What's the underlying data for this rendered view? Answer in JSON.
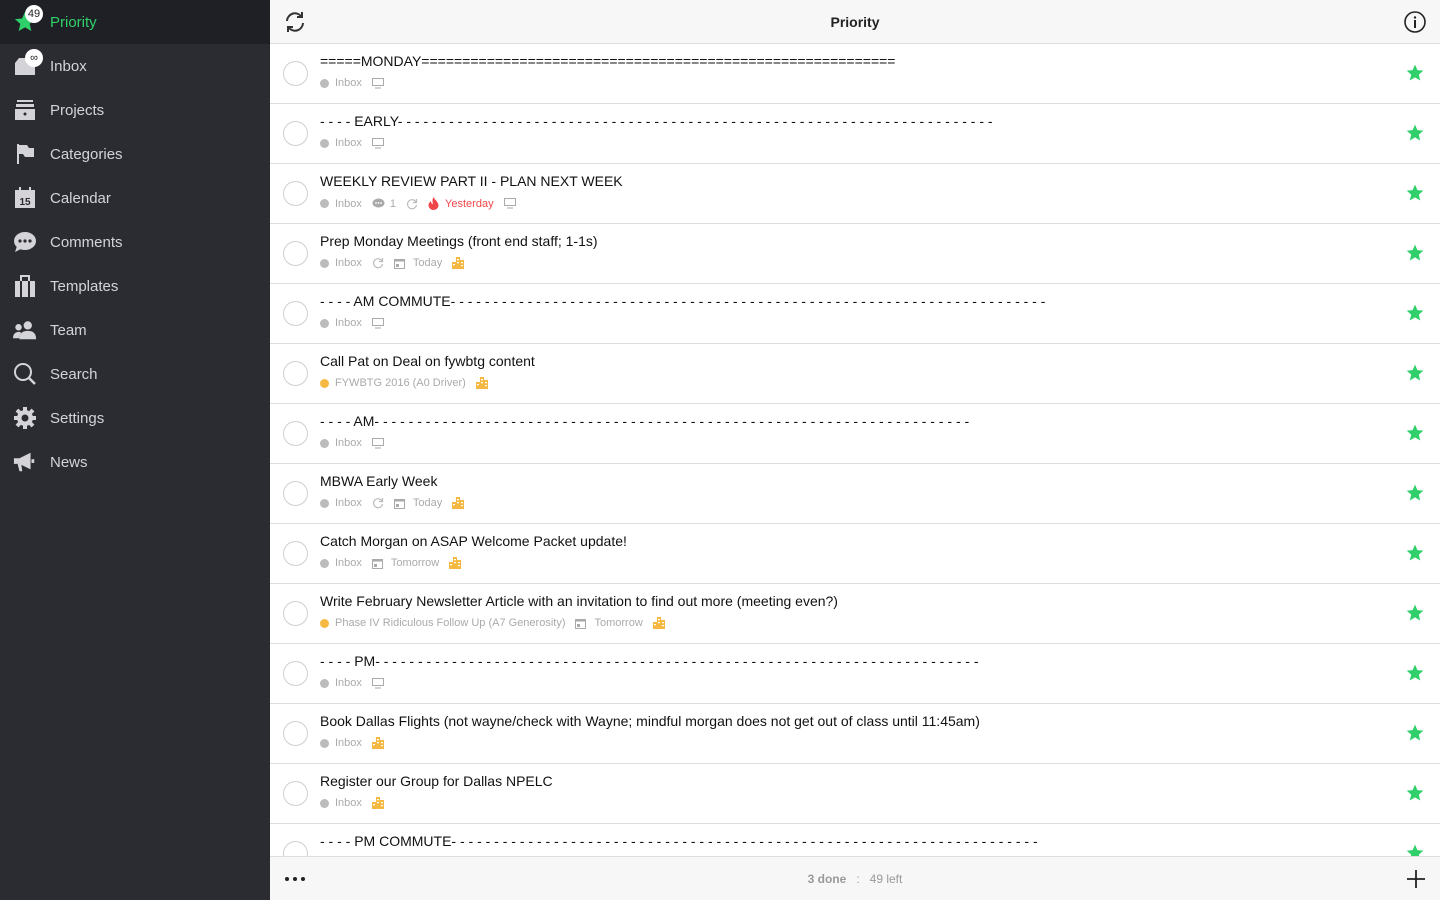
{
  "colors": {
    "accent": "#2fd06a",
    "sidebar": "#2b2c32",
    "overdue": "#f0464a",
    "project_orange": "#f5b942",
    "inbox_gray": "#bbbbbb"
  },
  "sidebar": {
    "items": [
      {
        "label": "Priority",
        "icon": "star-icon",
        "badge": "49",
        "active": true
      },
      {
        "label": "Inbox",
        "icon": "inbox-icon",
        "badge": "∞"
      },
      {
        "label": "Projects",
        "icon": "projects-icon"
      },
      {
        "label": "Categories",
        "icon": "flag-icon"
      },
      {
        "label": "Calendar",
        "icon": "calendar-icon",
        "icon_text": "15"
      },
      {
        "label": "Comments",
        "icon": "comment-icon"
      },
      {
        "label": "Templates",
        "icon": "templates-icon"
      },
      {
        "label": "Team",
        "icon": "team-icon"
      },
      {
        "label": "Search",
        "icon": "search-icon"
      },
      {
        "label": "Settings",
        "icon": "gear-icon"
      },
      {
        "label": "News",
        "icon": "megaphone-icon"
      }
    ]
  },
  "header": {
    "title": "Priority",
    "left_icon": "refresh-icon",
    "right_icon": "info-icon"
  },
  "tasks": [
    {
      "title": "=====MONDAY==========================================================",
      "meta": [
        {
          "t": "project",
          "text": "Inbox",
          "color": "#bbbbbb"
        },
        {
          "t": "monitor"
        }
      ]
    },
    {
      "title": "- - - - EARLY- - - - - - - - - - - - - - - - - - - - - - - - - - - - - - - - - - - - - - - - - - - - - - - - - - - - - - - - - - - - - - - - - - - - - -",
      "meta": [
        {
          "t": "project",
          "text": "Inbox",
          "color": "#bbbbbb"
        },
        {
          "t": "monitor"
        }
      ]
    },
    {
      "title": "WEEKLY REVIEW PART II - PLAN NEXT WEEK",
      "meta": [
        {
          "t": "project",
          "text": "Inbox",
          "color": "#bbbbbb"
        },
        {
          "t": "comment",
          "text": "1"
        },
        {
          "t": "repeat"
        },
        {
          "t": "overdue",
          "text": "Yesterday"
        },
        {
          "t": "monitor"
        }
      ]
    },
    {
      "title": "Prep Monday Meetings (front end staff; 1-1s)",
      "meta": [
        {
          "t": "project",
          "text": "Inbox",
          "color": "#bbbbbb"
        },
        {
          "t": "repeat"
        },
        {
          "t": "date",
          "text": "Today"
        },
        {
          "t": "building"
        }
      ]
    },
    {
      "title": "- - - - AM COMMUTE- - - - - - - - - - - - - - - - - - - - - - - - - - - - - - - - - - - - - - - - - - - - - - - - - - - - - - - - - - - - - - - - - - - - - -",
      "meta": [
        {
          "t": "project",
          "text": "Inbox",
          "color": "#bbbbbb"
        },
        {
          "t": "monitor"
        }
      ]
    },
    {
      "title": "Call Pat on Deal on fywbtg content",
      "meta": [
        {
          "t": "project",
          "text": "FYWBTG 2016 (A0 Driver)",
          "color": "#f5b942"
        },
        {
          "t": "building"
        }
      ]
    },
    {
      "title": "- - - - AM- - - - - - - - - - - - - - - - - - - - - - - - - - - - - - - - - - - - - - - - - - - - - - - - - - - - - - - - - - - - - - - - - - - - - -",
      "meta": [
        {
          "t": "project",
          "text": "Inbox",
          "color": "#bbbbbb"
        },
        {
          "t": "monitor"
        }
      ]
    },
    {
      "title": "MBWA Early Week",
      "meta": [
        {
          "t": "project",
          "text": "Inbox",
          "color": "#bbbbbb"
        },
        {
          "t": "repeat"
        },
        {
          "t": "date",
          "text": "Today"
        },
        {
          "t": "building"
        }
      ]
    },
    {
      "title": "Catch Morgan on ASAP Welcome Packet update!",
      "meta": [
        {
          "t": "project",
          "text": "Inbox",
          "color": "#bbbbbb"
        },
        {
          "t": "date",
          "text": "Tomorrow"
        },
        {
          "t": "building"
        }
      ]
    },
    {
      "title": "Write February Newsletter Article with an invitation to find out more (meeting even?)",
      "meta": [
        {
          "t": "project",
          "text": "Phase IV Ridiculous Follow Up (A7 Generosity)",
          "color": "#f5b942"
        },
        {
          "t": "date",
          "text": "Tomorrow"
        },
        {
          "t": "building"
        }
      ]
    },
    {
      "title": "- - - - PM- - - - - - - - - - - - - - - - - - - - - - - - - - - - - - - - - - - - - - - - - - - - - - - - - - - - - - - - - - - - - - - - - - - - - - -",
      "meta": [
        {
          "t": "project",
          "text": "Inbox",
          "color": "#bbbbbb"
        },
        {
          "t": "monitor"
        }
      ]
    },
    {
      "title": "Book Dallas Flights (not wayne/check with Wayne; mindful morgan does not get out of class until 11:45am)",
      "meta": [
        {
          "t": "project",
          "text": "Inbox",
          "color": "#bbbbbb"
        },
        {
          "t": "building"
        }
      ]
    },
    {
      "title": "Register our Group for Dallas NPELC",
      "meta": [
        {
          "t": "project",
          "text": "Inbox",
          "color": "#bbbbbb"
        },
        {
          "t": "building"
        }
      ]
    },
    {
      "title": "- - - - PM COMMUTE- - - - - - - - - - - - - - - - - - - - - - - - - - - - - - - - - - - - - - - - - - - - - - - - - - - - - - - - - - - - - - - - - - - - -",
      "meta": []
    }
  ],
  "footer": {
    "done": "3 done",
    "sep": ":",
    "left": "49 left",
    "more_icon": "more-icon",
    "add_icon": "plus-icon"
  }
}
